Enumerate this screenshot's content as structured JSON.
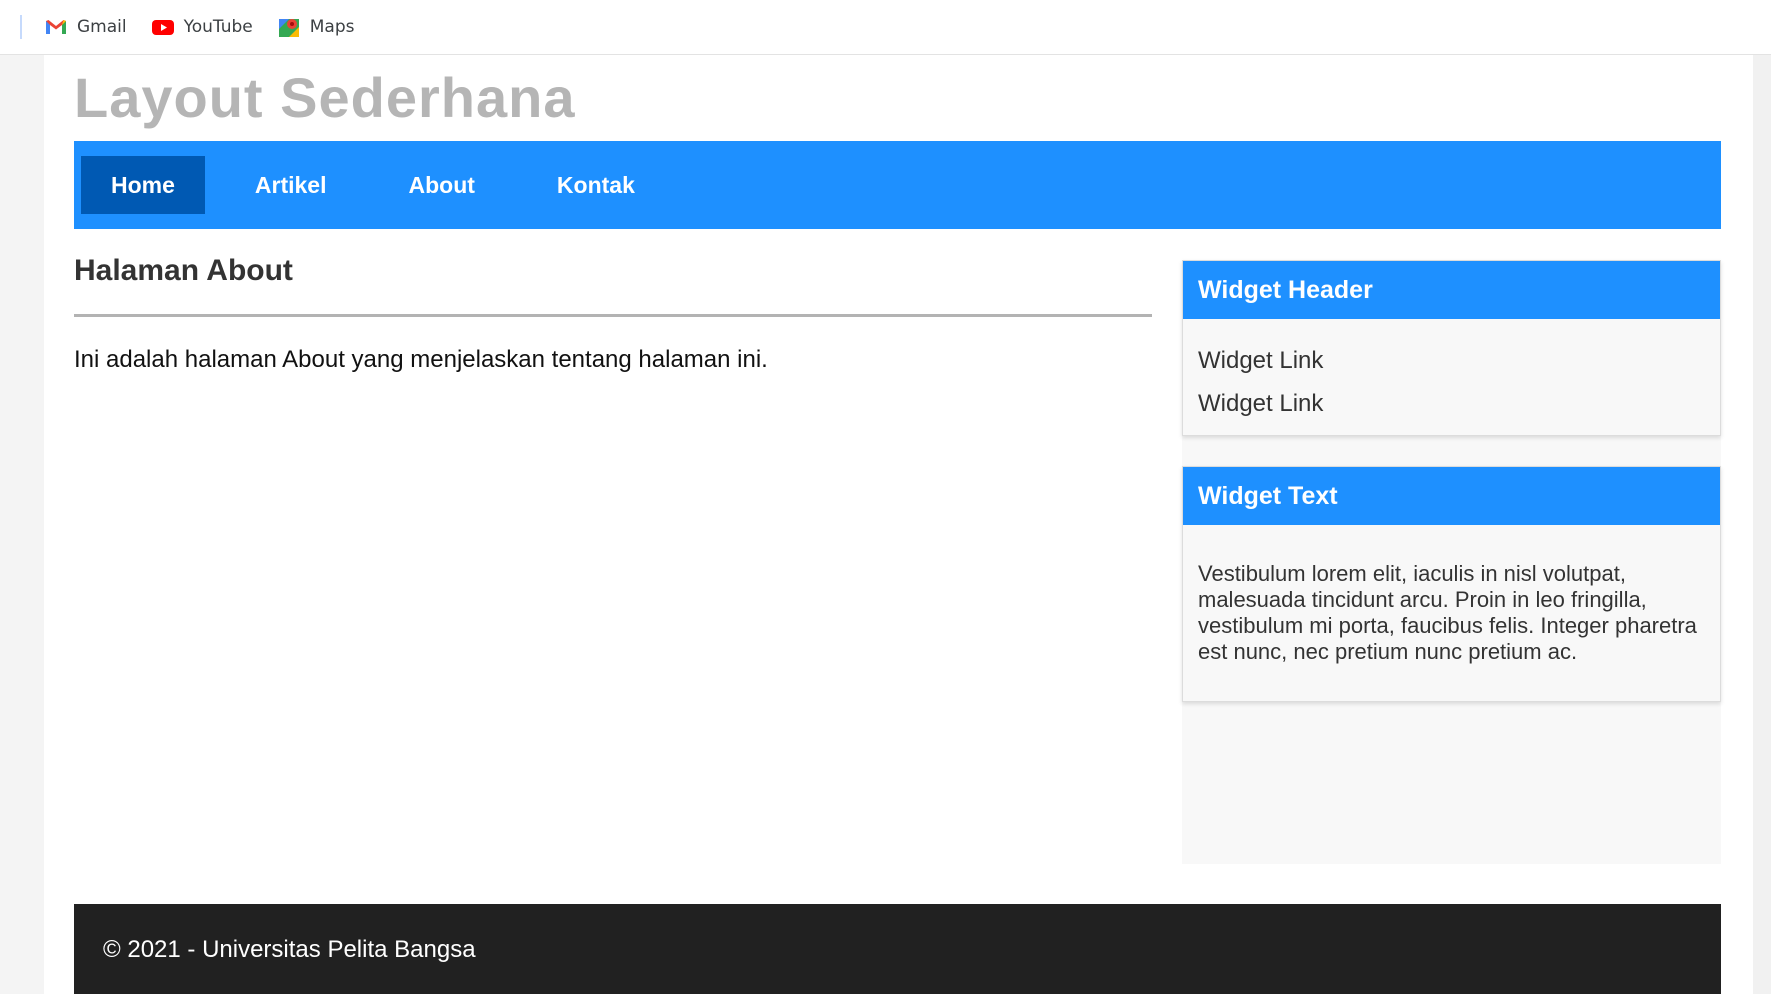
{
  "bookmarks": [
    {
      "label": "Gmail",
      "icon": "gmail-icon"
    },
    {
      "label": "YouTube",
      "icon": "youtube-icon"
    },
    {
      "label": "Maps",
      "icon": "maps-icon"
    }
  ],
  "site": {
    "title": "Layout Sederhana"
  },
  "nav": {
    "items": [
      {
        "label": "Home",
        "active": true
      },
      {
        "label": "Artikel",
        "active": false
      },
      {
        "label": "About",
        "active": false
      },
      {
        "label": "Kontak",
        "active": false
      }
    ]
  },
  "main": {
    "heading": "Halaman About",
    "paragraph": "Ini adalah halaman About yang menjelaskan tentang halaman ini."
  },
  "sidebar": {
    "widget_links": {
      "header": "Widget Header",
      "links": [
        "Widget Link",
        "Widget Link"
      ]
    },
    "widget_text": {
      "header": "Widget Text",
      "text": "Vestibulum lorem elit, iaculis in nisl volutpat, malesuada tincidunt arcu. Proin in leo fringilla, vestibulum mi porta, faucibus felis. Integer pharetra est nunc, nec pretium nunc pretium ac."
    }
  },
  "footer": {
    "text": "© 2021 - Universitas Pelita Bangsa"
  },
  "colors": {
    "nav_bg": "#1e90ff",
    "nav_active": "#0059b3",
    "footer_bg": "#212121",
    "title": "#b5b5b5"
  }
}
